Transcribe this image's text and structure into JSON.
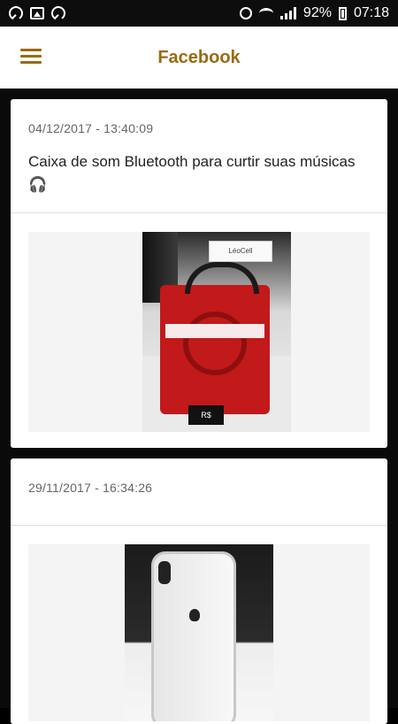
{
  "status_bar": {
    "battery_percent": "92%",
    "time": "07:18",
    "icons": [
      "whatsapp-icon",
      "gallery-icon",
      "whatsapp-icon",
      "alarm-icon",
      "wifi-icon",
      "signal-icon",
      "battery-icon"
    ]
  },
  "app_bar": {
    "title": "Facebook",
    "menu_icon": "hamburger-menu-icon",
    "accent_color": "#9a6a12"
  },
  "posts": [
    {
      "timestamp": "04/12/2017 - 13:40:09",
      "caption": "Caixa de som Bluetooth para curtir suas músicas 🎧",
      "image": {
        "store_sign": "LéoCell",
        "price_tag": "R$ 132,00"
      }
    },
    {
      "timestamp": "29/11/2017 - 16:34:26",
      "caption": "",
      "image": {}
    }
  ]
}
